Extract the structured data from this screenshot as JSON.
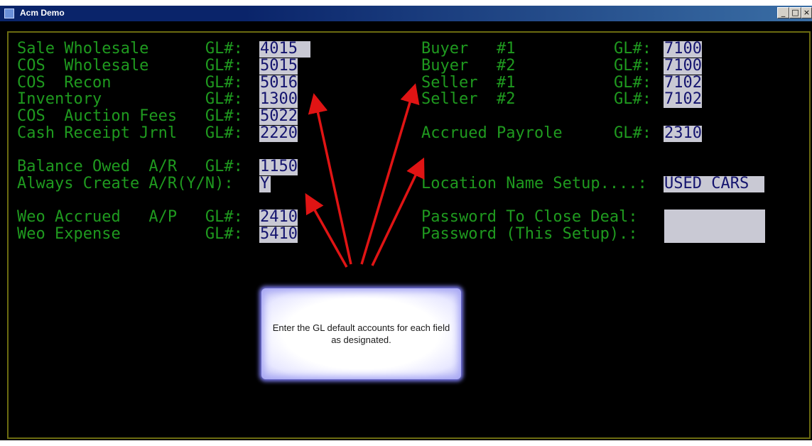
{
  "window": {
    "title": "Acm Demo",
    "minimize": "_",
    "maximize": "□",
    "close": "×"
  },
  "left_fields": [
    {
      "label": "Sale Wholesale      GL#:",
      "value": "4015 "
    },
    {
      "label": "COS  Wholesale      GL#:",
      "value": "5015"
    },
    {
      "label": "COS  Recon          GL#:",
      "value": "5016"
    },
    {
      "label": "Inventory           GL#:",
      "value": "1300"
    },
    {
      "label": "COS  Auction Fees   GL#:",
      "value": "5022"
    },
    {
      "label": "Cash Receipt Jrnl   GL#:",
      "value": "2220"
    },
    {
      "label": "Balance Owed  A/R   GL#:",
      "value": "1150"
    },
    {
      "label": "Always Create A/R(Y/N):",
      "value": "Y"
    },
    {
      "label": "Weo Accrued   A/P   GL#:",
      "value": "2410"
    },
    {
      "label": "Weo Expense         GL#:",
      "value": "5410"
    }
  ],
  "right_fields": [
    {
      "label": "Buyer   #1",
      "gl": "GL#:",
      "value": "7100"
    },
    {
      "label": "Buyer   #2",
      "gl": "GL#:",
      "value": "7100"
    },
    {
      "label": "Seller  #1",
      "gl": "GL#:",
      "value": "7102"
    },
    {
      "label": "Seller  #2",
      "gl": "GL#:",
      "value": "7102"
    }
  ],
  "accrued_payrole": {
    "label": "Accrued Payrole",
    "gl": "GL#:",
    "value": "2310"
  },
  "location": {
    "label": "Location Name Setup....:",
    "value": "USED CARS "
  },
  "password_close": {
    "label": "Password To Close Deal:"
  },
  "password_setup": {
    "label": "Password (This Setup).:"
  },
  "callout": {
    "text": "Enter the GL default accounts for each field as designated."
  },
  "colors": {
    "console_bg": "#000000",
    "console_text": "#1f9a1f",
    "field_bg": "#c9c9d4",
    "field_text": "#14146e",
    "arrow": "#e01414",
    "frame": "#6b6b10",
    "titlebar": "#0a246a"
  }
}
